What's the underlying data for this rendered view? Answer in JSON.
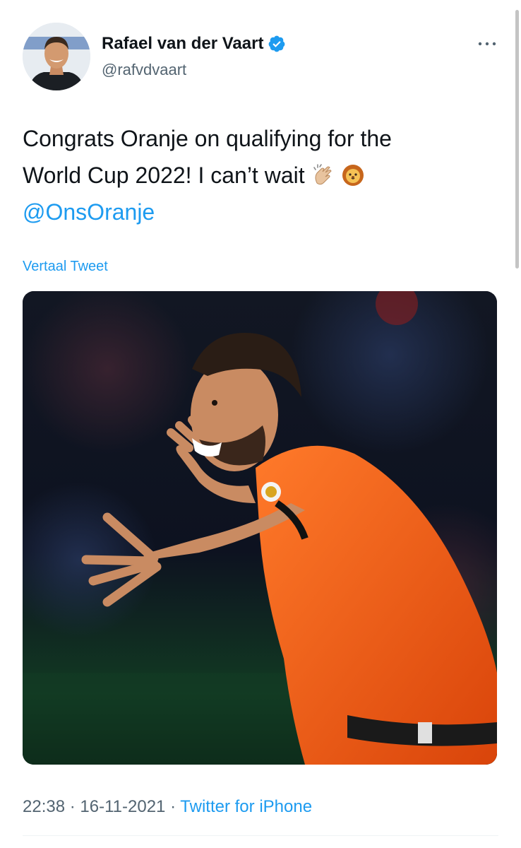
{
  "tweet": {
    "author": {
      "display_name": "Rafael van der Vaart",
      "handle": "@rafvdvaart",
      "verified": true,
      "verified_icon": "verified-badge-icon",
      "avatar": "profile-photo"
    },
    "more_icon": "more-options-icon",
    "text_line1": "Congrats Oranje on qualifying for the",
    "text_line2_prefix": "World Cup 2022! I can’t wait",
    "emojis": [
      "clapping-hands-emoji",
      "lion-emoji"
    ],
    "mention": "@OnsOranje",
    "translate_label": "Vertaal Tweet",
    "media": {
      "type": "photo",
      "subject": "footballer in orange shirt celebrating"
    },
    "time": "22:38",
    "separator": "·",
    "date": "16-11-2021",
    "source": "Twitter for iPhone"
  },
  "colors": {
    "link": "#1d9bf0",
    "text": "#0f1419",
    "secondary": "#536471",
    "shirt": "#f05a13"
  }
}
